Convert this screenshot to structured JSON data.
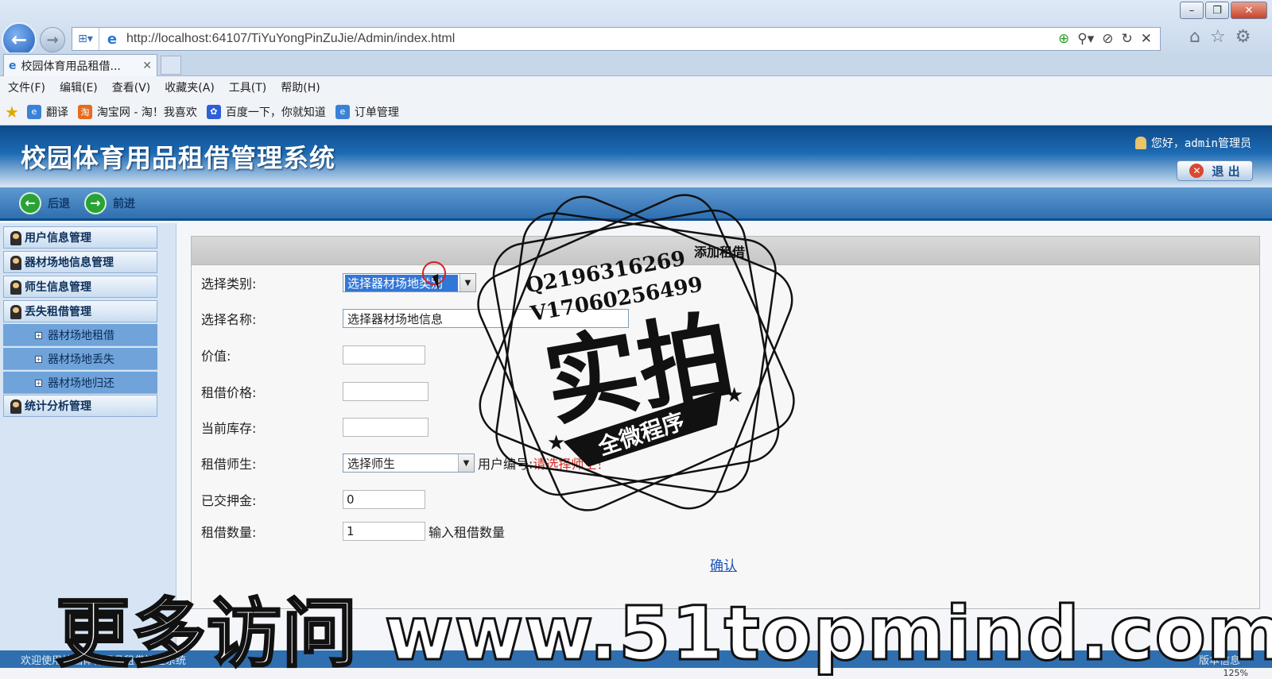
{
  "browser": {
    "url": "http://localhost:64107/TiYuYongPinZuJie/Admin/index.html",
    "tab_title": "校园体育用品租借...",
    "menu": [
      "文件(F)",
      "编辑(E)",
      "查看(V)",
      "收藏夹(A)",
      "工具(T)",
      "帮助(H)"
    ],
    "favorites": [
      "翻译",
      "淘宝网 - 淘！我喜欢",
      "百度一下，你就知道",
      "订单管理"
    ]
  },
  "app": {
    "title": "校园体育用品租借管理系统",
    "greeting": "您好，admin管理员",
    "logout_label": "退 出",
    "back_label": "后退",
    "forward_label": "前进"
  },
  "sidebar": {
    "items": [
      {
        "label": "用户信息管理"
      },
      {
        "label": "器材场地信息管理"
      },
      {
        "label": "师生信息管理"
      },
      {
        "label": "丢失租借管理"
      }
    ],
    "subitems": [
      {
        "label": "器材场地租借"
      },
      {
        "label": "器材场地丢失"
      },
      {
        "label": "器材场地归还"
      }
    ],
    "last_item": {
      "label": "统计分析管理"
    }
  },
  "form": {
    "title": "添加租借",
    "category_label": "选择类别:",
    "category_value": "选择器材场地类别",
    "name_label": "选择名称:",
    "name_value": "选择器材场地信息",
    "value_label": "价值:",
    "value_value": "",
    "price_label": "租借价格:",
    "price_value": "",
    "stock_label": "当前库存:",
    "stock_value": "",
    "person_label": "租借师生:",
    "person_value": "选择师生",
    "user_no_label": "用户编号:",
    "user_no_error": "请选择师生！",
    "deposit_label": "已交押金:",
    "deposit_value": "0",
    "qty_label": "租借数量:",
    "qty_value": "1",
    "qty_hint": "输入租借数量",
    "confirm_label": "确认"
  },
  "watermark": {
    "qq": "Q2196316269",
    "wx": "V17060256499",
    "big": "实拍",
    "ribbon": "全微程序",
    "overlay": "更多访问 www.51topmind.com"
  },
  "footer": {
    "welcome": "欢迎使用校园体育用品租借管理系统",
    "version": "版本信息",
    "zoom": "125%"
  }
}
